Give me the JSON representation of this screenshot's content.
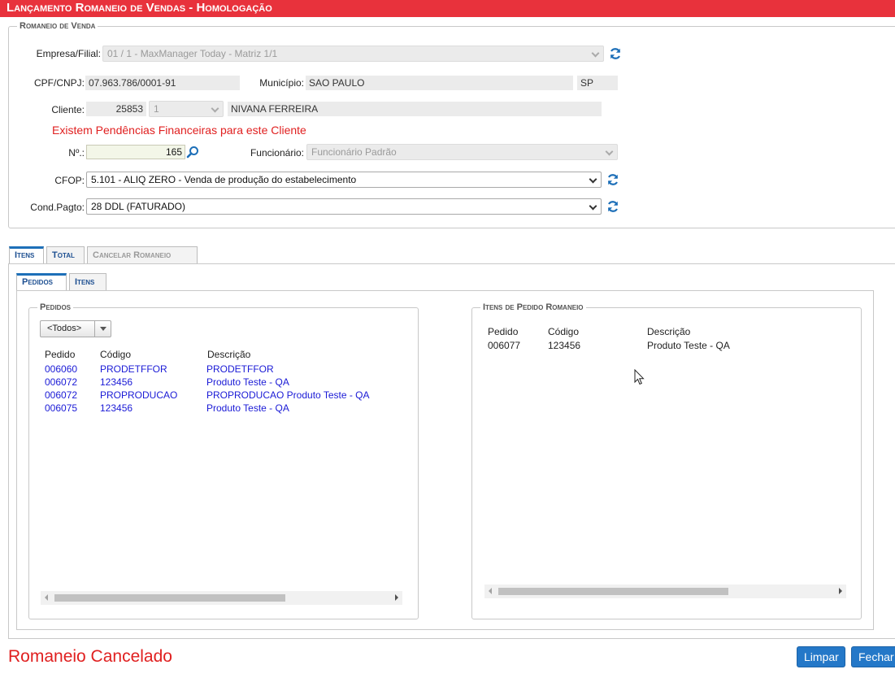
{
  "window": {
    "title": "Lançamento Romaneio de Vendas  - Homologação"
  },
  "romaneio": {
    "legend": "Romaneio de Venda",
    "empresa_label": "Empresa/Filial:",
    "empresa_value": "01 / 1 - MaxManager Today - Matriz 1/1",
    "cpf_label": "CPF/CNPJ:",
    "cpf_value": "07.963.786/0001-91",
    "municipio_label": "Município:",
    "municipio_value": "SAO PAULO",
    "uf_value": "SP",
    "cliente_label": "Cliente:",
    "cliente_code": "25853",
    "cliente_seq": "1",
    "cliente_name": "NIVANA FERREIRA",
    "warning": "Existem Pendências Financeiras para este Cliente",
    "numero_label": "Nº.:",
    "numero_value": "165",
    "funcionario_label": "Funcionário:",
    "funcionario_value": "Funcionário Padrão",
    "cfop_label": "CFOP:",
    "cfop_value": "5.101 - ALIQ ZERO - Venda de produção do estabelecimento",
    "condpagto_label": "Cond.Pagto:",
    "condpagto_value": "28 DDL (FATURADO)"
  },
  "main_tabs": [
    {
      "label": "Itens",
      "active": true
    },
    {
      "label": "Total",
      "active": false
    },
    {
      "label": "Cancelar Romaneio",
      "active": false,
      "disabled": true
    }
  ],
  "sub_tabs": [
    {
      "label": "Pedidos",
      "active": true
    },
    {
      "label": "Itens",
      "active": false
    }
  ],
  "pedidos": {
    "legend": "Pedidos",
    "filter_value": "<Todos>",
    "columns": [
      "Pedido",
      "Código",
      "Descrição"
    ],
    "rows": [
      {
        "pedido": "006060",
        "codigo": "PRODETFFOR",
        "descricao": "PRODETFFOR"
      },
      {
        "pedido": "006072",
        "codigo": "123456",
        "descricao": "Produto Teste - QA"
      },
      {
        "pedido": "006072",
        "codigo": "PROPRODUCAO",
        "descricao": "PROPRODUCAO Produto Teste - QA"
      },
      {
        "pedido": "006075",
        "codigo": "123456",
        "descricao": "Produto Teste - QA"
      }
    ]
  },
  "itens_pedido": {
    "legend": "Itens de Pedido Romaneio",
    "columns": [
      "Pedido",
      "Código",
      "Descrição"
    ],
    "rows": [
      {
        "pedido": "006077",
        "codigo": "123456",
        "descricao": "Produto Teste - QA"
      }
    ]
  },
  "footer": {
    "status": "Romaneio Cancelado",
    "limpar_label": "Limpar",
    "fechar_label": "Fechar"
  },
  "colors": {
    "title_bar": "#e8323c",
    "warning": "#e02020",
    "link": "#1a1ad6",
    "accent": "#2478c8"
  },
  "icons": [
    "refresh-icon",
    "search-icon",
    "chevron-down-icon",
    "mouse-cursor-icon"
  ]
}
